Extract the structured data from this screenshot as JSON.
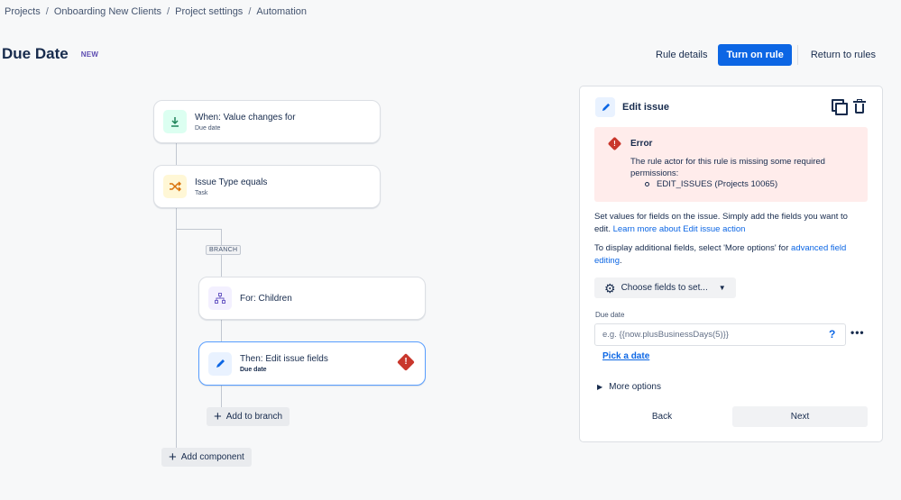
{
  "breadcrumb": [
    "Projects",
    "Onboarding New Clients",
    "Project settings",
    "Automation"
  ],
  "page": {
    "title": "Due Date",
    "badge": "NEW"
  },
  "top_actions": {
    "rule_details": "Rule details",
    "turn_on": "Turn on rule",
    "return": "Return to rules"
  },
  "flow": {
    "trigger": {
      "label": "When: Value changes for",
      "sub": "Due date",
      "icon": "field-change-icon"
    },
    "condition": {
      "label": "Issue Type equals",
      "sub": "Task",
      "icon": "shuffle-icon"
    },
    "branch_tag": "BRANCH",
    "branch": {
      "label": "For: Children",
      "icon": "hierarchy-icon"
    },
    "action": {
      "label": "Then: Edit issue fields",
      "sub": "Due date",
      "icon": "pencil-icon",
      "status": "error"
    },
    "add_to_branch": "Add to branch",
    "add_component": "Add component"
  },
  "panel": {
    "title": "Edit issue",
    "error": {
      "title": "Error",
      "message": "The rule actor for this rule is missing some required permissions:",
      "items": [
        "EDIT_ISSUES (Projects 10065)"
      ]
    },
    "desc1_text": "Set values for fields on the issue. Simply add the fields you want to edit. ",
    "desc1_link": "Learn more about Edit issue action",
    "desc2_text": "To display additional fields, select 'More options' for ",
    "desc2_link": "advanced field editing",
    "desc2_end": ".",
    "choose_fields": "Choose fields to set...",
    "field_label": "Due date",
    "field_placeholder": "e.g. {{now.plusBusinessDays(5)}}",
    "field_help": "?",
    "field_more": "•••",
    "pick_date": "Pick a date",
    "more_options": "More options",
    "back": "Back",
    "next": "Next"
  },
  "colors": {
    "primary": "#0c66e4",
    "error": "#c9372c",
    "error_bg": "#ffeceb"
  }
}
